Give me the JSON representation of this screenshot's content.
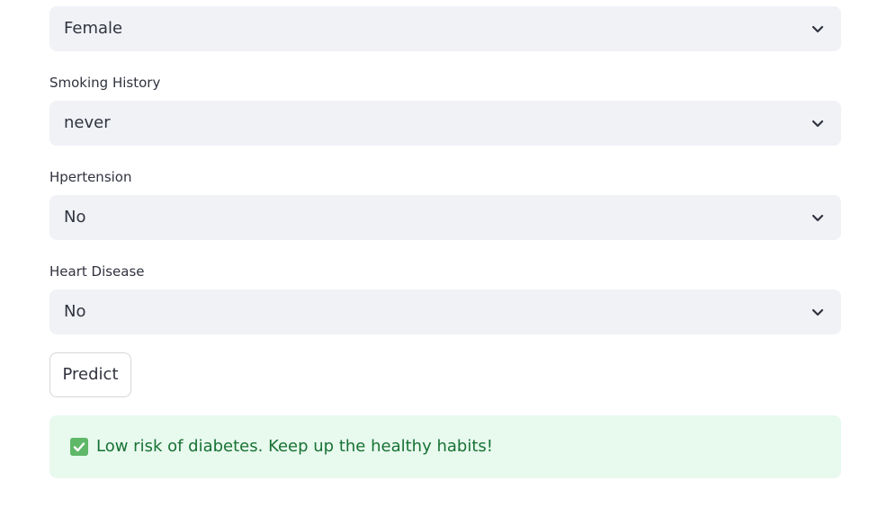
{
  "fields": [
    {
      "label": "",
      "value": "Female"
    },
    {
      "label": "Smoking History",
      "value": "never"
    },
    {
      "label": "Hpertension",
      "value": "No"
    },
    {
      "label": "Heart Disease",
      "value": "No"
    }
  ],
  "predict_button": {
    "label": "Predict"
  },
  "result": {
    "icon": "check-box-icon",
    "message": "Low risk of diabetes. Keep up the healthy habits!",
    "color": "#177233",
    "background": "#e8f9ee"
  }
}
